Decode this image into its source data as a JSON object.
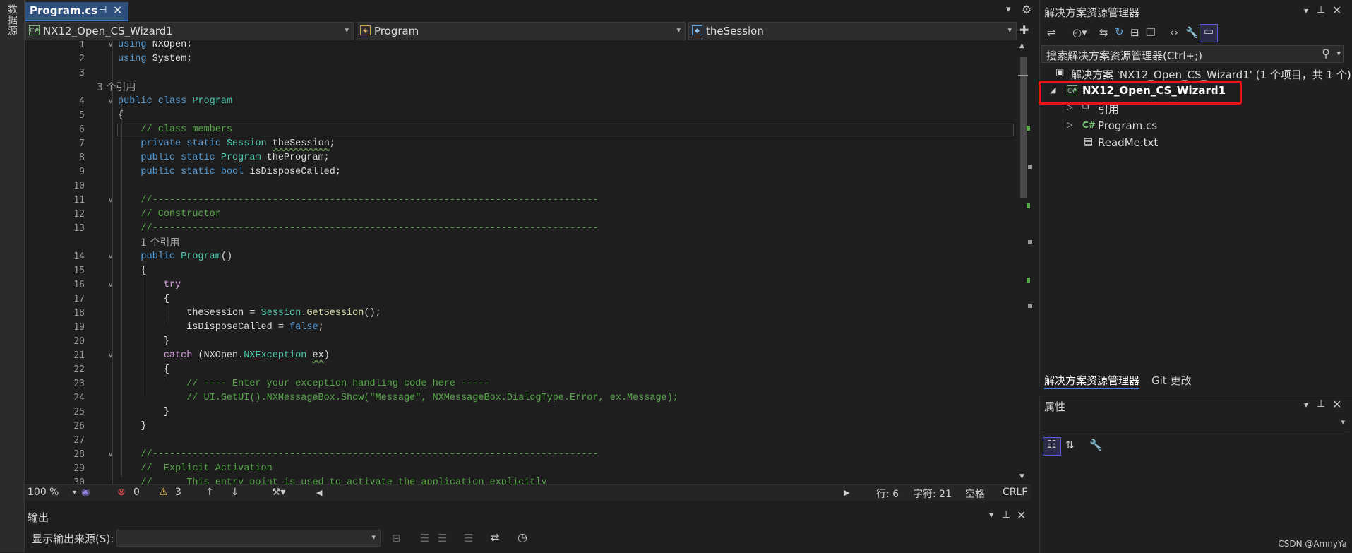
{
  "left_strip": {
    "label": "数据源"
  },
  "tab": {
    "title": "Program.cs",
    "pin_icon": "⊣",
    "close_icon": "✕"
  },
  "tab_tools": {
    "dropdown": "▾",
    "settings": "⚙"
  },
  "nav": {
    "project": "NX12_Open_CS_Wizard1",
    "class": "Program",
    "member": "theSession",
    "split_icon": "✚"
  },
  "editor": {
    "rows": [
      {
        "ln": "1",
        "fold": "∨",
        "html": [
          [
            "kw",
            "using"
          ],
          [
            "id",
            " NXOpen;"
          ]
        ]
      },
      {
        "ln": "2",
        "fold": "",
        "html": [
          [
            "kw",
            "using"
          ],
          [
            "id",
            " System;"
          ]
        ]
      },
      {
        "ln": "3",
        "fold": "",
        "html": []
      },
      {
        "ln": "",
        "fold": "",
        "hint": "3 个引用",
        "indent": 0
      },
      {
        "ln": "4",
        "fold": "∨",
        "html": [
          [
            "kw",
            "public"
          ],
          [
            "id",
            " "
          ],
          [
            "kw",
            "class"
          ],
          [
            "id",
            " "
          ],
          [
            "type",
            "Program"
          ]
        ]
      },
      {
        "ln": "5",
        "fold": "",
        "html": [
          [
            "punc",
            "{"
          ]
        ]
      },
      {
        "ln": "6",
        "fold": "",
        "html": [
          [
            "id",
            "    "
          ],
          [
            "cmt",
            "// class members"
          ]
        ],
        "current": true
      },
      {
        "ln": "7",
        "fold": "",
        "html": [
          [
            "id",
            "    "
          ],
          [
            "kw",
            "private"
          ],
          [
            "id",
            " "
          ],
          [
            "kw",
            "static"
          ],
          [
            "id",
            " "
          ],
          [
            "type",
            "Session"
          ],
          [
            "id",
            " "
          ],
          [
            "sq",
            "theSession"
          ],
          [
            "id",
            ";"
          ]
        ]
      },
      {
        "ln": "8",
        "fold": "",
        "html": [
          [
            "id",
            "    "
          ],
          [
            "kw",
            "public"
          ],
          [
            "id",
            " "
          ],
          [
            "kw",
            "static"
          ],
          [
            "id",
            " "
          ],
          [
            "type",
            "Program"
          ],
          [
            "id",
            " theProgram;"
          ]
        ]
      },
      {
        "ln": "9",
        "fold": "",
        "html": [
          [
            "id",
            "    "
          ],
          [
            "kw",
            "public"
          ],
          [
            "id",
            " "
          ],
          [
            "kw",
            "static"
          ],
          [
            "id",
            " "
          ],
          [
            "kw",
            "bool"
          ],
          [
            "id",
            " isDisposeCalled;"
          ]
        ]
      },
      {
        "ln": "10",
        "fold": "",
        "html": []
      },
      {
        "ln": "11",
        "fold": "∨",
        "html": [
          [
            "id",
            "    "
          ],
          [
            "cmt",
            "//------------------------------------------------------------------------------"
          ]
        ]
      },
      {
        "ln": "12",
        "fold": "",
        "html": [
          [
            "id",
            "    "
          ],
          [
            "cmt",
            "// Constructor"
          ]
        ]
      },
      {
        "ln": "13",
        "fold": "",
        "html": [
          [
            "id",
            "    "
          ],
          [
            "cmt",
            "//------------------------------------------------------------------------------"
          ]
        ]
      },
      {
        "ln": "",
        "fold": "",
        "hint": "1 个引用",
        "indent": 1
      },
      {
        "ln": "14",
        "fold": "∨",
        "html": [
          [
            "id",
            "    "
          ],
          [
            "kw",
            "public"
          ],
          [
            "id",
            " "
          ],
          [
            "type",
            "Program"
          ],
          [
            "id",
            "()"
          ]
        ]
      },
      {
        "ln": "15",
        "fold": "",
        "html": [
          [
            "id",
            "    {"
          ]
        ]
      },
      {
        "ln": "16",
        "fold": "∨",
        "html": [
          [
            "id",
            "        "
          ],
          [
            "ctl",
            "try"
          ]
        ]
      },
      {
        "ln": "17",
        "fold": "",
        "html": [
          [
            "id",
            "        {"
          ]
        ]
      },
      {
        "ln": "18",
        "fold": "",
        "html": [
          [
            "id",
            "            theSession = "
          ],
          [
            "type",
            "Session"
          ],
          [
            "id",
            "."
          ],
          [
            "fn",
            "GetSession"
          ],
          [
            "id",
            "();"
          ]
        ]
      },
      {
        "ln": "19",
        "fold": "",
        "html": [
          [
            "id",
            "            isDisposeCalled = "
          ],
          [
            "kw",
            "false"
          ],
          [
            "id",
            ";"
          ]
        ]
      },
      {
        "ln": "20",
        "fold": "",
        "html": [
          [
            "id",
            "        }"
          ]
        ]
      },
      {
        "ln": "21",
        "fold": "∨",
        "html": [
          [
            "id",
            "        "
          ],
          [
            "ctl",
            "catch"
          ],
          [
            "id",
            " ("
          ],
          [
            "id",
            "NXOpen."
          ],
          [
            "type",
            "NXException"
          ],
          [
            "id",
            " "
          ],
          [
            "sq",
            "ex"
          ],
          [
            "id",
            ")"
          ]
        ]
      },
      {
        "ln": "22",
        "fold": "",
        "html": [
          [
            "id",
            "        {"
          ]
        ]
      },
      {
        "ln": "23",
        "fold": "",
        "html": [
          [
            "id",
            "            "
          ],
          [
            "cmt",
            "// ---- Enter your exception handling code here -----"
          ]
        ]
      },
      {
        "ln": "24",
        "fold": "",
        "html": [
          [
            "id",
            "            "
          ],
          [
            "cmt",
            "// UI.GetUI().NXMessageBox.Show(\"Message\", NXMessageBox.DialogType.Error, ex.Message);"
          ]
        ]
      },
      {
        "ln": "25",
        "fold": "",
        "html": [
          [
            "id",
            "        }"
          ]
        ]
      },
      {
        "ln": "26",
        "fold": "",
        "html": [
          [
            "id",
            "    }"
          ]
        ]
      },
      {
        "ln": "27",
        "fold": "",
        "html": []
      },
      {
        "ln": "28",
        "fold": "∨",
        "html": [
          [
            "id",
            "    "
          ],
          [
            "cmt",
            "//------------------------------------------------------------------------------"
          ]
        ]
      },
      {
        "ln": "29",
        "fold": "",
        "html": [
          [
            "id",
            "    "
          ],
          [
            "cmt",
            "//  Explicit Activation"
          ]
        ]
      },
      {
        "ln": "30",
        "fold": "",
        "html": [
          [
            "id",
            "    "
          ],
          [
            "cmt",
            "//      This entry point is used to activate the application explicitly"
          ]
        ]
      }
    ]
  },
  "status": {
    "zoom": "100 %",
    "errors": "0",
    "warnings": "3",
    "row": "行: 6",
    "col": "字符: 21",
    "spaces": "空格",
    "eol": "CRLF"
  },
  "output": {
    "title": "输出",
    "source_label": "显示输出来源(S):",
    "source_value": ""
  },
  "solution_explorer": {
    "title": "解决方案资源管理器",
    "search_placeholder": "搜索解决方案资源管理器(Ctrl+;)",
    "solution_line": "解决方案 'NX12_Open_CS_Wizard1' (1 个项目，共 1 个)",
    "project": "NX12_Open_CS_Wizard1",
    "items": [
      "引用",
      "Program.cs",
      "ReadMe.txt"
    ],
    "tabs": [
      "解决方案资源管理器",
      "Git 更改"
    ]
  },
  "properties": {
    "title": "属性"
  },
  "watermark": "CSDN @AmnyYa",
  "colors": {
    "accent": "#3f7ad6",
    "highlight_box": "#e81515",
    "comment": "#57a64a",
    "keyword": "#569cd6",
    "type": "#4ec9b0"
  }
}
